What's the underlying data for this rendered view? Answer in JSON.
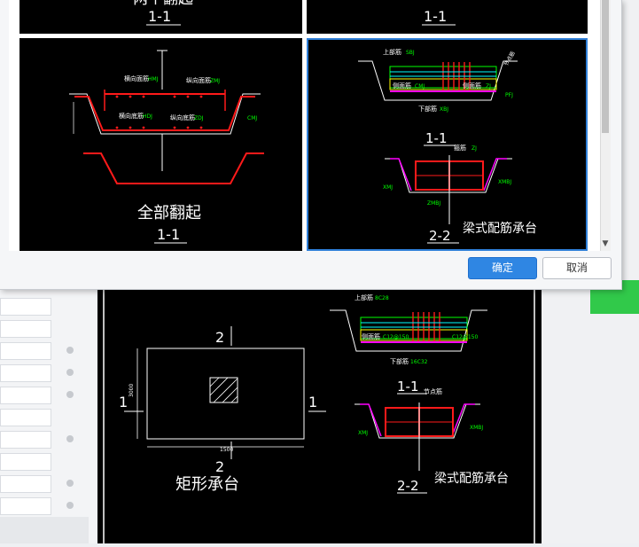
{
  "dialog": {
    "ok_label": "确定",
    "cancel_label": "取消",
    "thumbnails": {
      "top_left_title": "两个翻起",
      "top_left_section": "1-1",
      "top_right_section": "1-1",
      "middle_left": {
        "title": "全部翻起",
        "section": "1-1",
        "labels": [
          "横向面筋",
          "纵向面筋",
          "横向底筋",
          "纵向底筋"
        ],
        "rebar_codes": [
          "HMJ",
          "ZMJ",
          "HDJ",
          "ZDJ",
          "CMJ"
        ]
      },
      "middle_right": {
        "title": "梁式配筋承台",
        "section_1": "1-1",
        "section_2": "2-2",
        "labels": [
          "上部筋",
          "侧面筋",
          "侧面筋",
          "下部筋",
          "箍筋",
          "节点筋"
        ],
        "rebar_codes": [
          "SBJ",
          "CMJ",
          "XBJ",
          "GJ",
          "ZJ",
          "XMBJ",
          "ZMBJ",
          "PFJ",
          "XMJ"
        ]
      }
    }
  },
  "canvas": {
    "plan_title": "矩形承台",
    "plan_marks": [
      "2",
      "1",
      "1",
      "2"
    ],
    "plan_dims": [
      "3000",
      "1500"
    ],
    "section_1": "1-1",
    "section_2": "2-2",
    "beam_title": "梁式配筋承台",
    "labels": [
      "上部筋",
      "侧面筋",
      "下部筋",
      "箍筋",
      "节点筋"
    ],
    "rebar_codes": [
      "8C28",
      "C12@150",
      "16C32",
      "GJ",
      "XMJ",
      "XMBJ",
      "ZMBJ"
    ]
  },
  "colors": {
    "accent": "#2f86e3",
    "selection": "#2f7fd8",
    "cad_white": "#ffffff",
    "cad_red": "#ff1a1a",
    "cad_green": "#00ff00",
    "cad_yellow": "#ffff00",
    "cad_cyan": "#00ffff",
    "cad_magenta": "#ff00ff",
    "app_green": "#31c94a"
  }
}
